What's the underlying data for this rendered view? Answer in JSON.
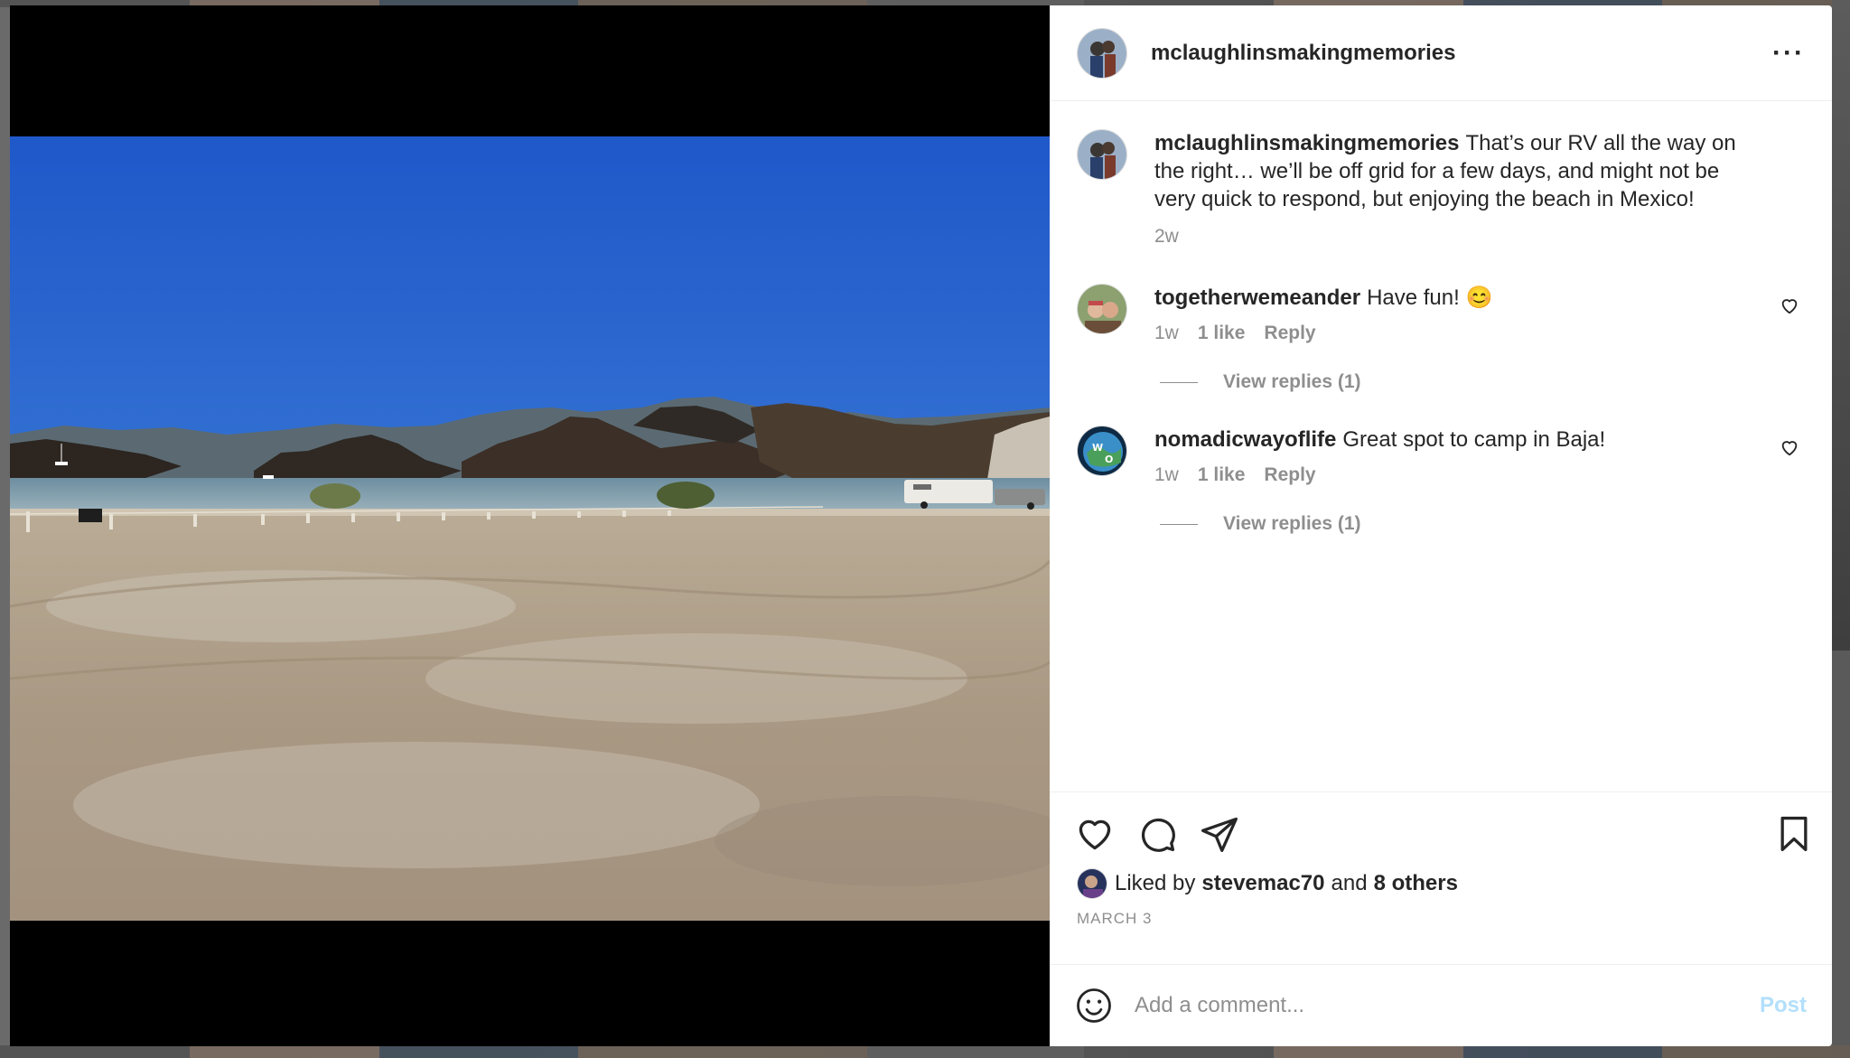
{
  "post": {
    "username": "mclaughlinsmakingmemories",
    "more_label": "···"
  },
  "caption": {
    "username": "mclaughlinsmakingmemories",
    "text": "That’s our RV all the way on the right… we’ll be off grid for a few days, and might not be very quick to respond, but enjoying the beach in Mexico!",
    "age": "2w"
  },
  "comments": [
    {
      "username": "togetherwemeander",
      "text": "Have fun! 😊",
      "age": "1w",
      "likes": "1 like",
      "reply_label": "Reply",
      "view_replies": "View replies (1)"
    },
    {
      "username": "nomadicwayoflife",
      "text": "Great spot to camp in Baja!",
      "age": "1w",
      "likes": "1 like",
      "reply_label": "Reply",
      "view_replies": "View replies (1)"
    }
  ],
  "likes": {
    "prefix": "Liked by",
    "user": "stevemac70",
    "conjunction": "and",
    "others": "8 others"
  },
  "date": "MARCH 3",
  "comment_box": {
    "placeholder": "Add a comment...",
    "post_label": "Post"
  },
  "icons": {
    "like": "heart-icon",
    "comment": "comment-bubble-icon",
    "share": "paper-plane-icon",
    "save": "bookmark-icon",
    "emoji": "smiley-icon",
    "more": "more-horizontal-icon"
  },
  "colors": {
    "text": "#262626",
    "secondary": "#8e8e8e",
    "post_disabled": "#b2dffc",
    "divider": "#efefef"
  }
}
